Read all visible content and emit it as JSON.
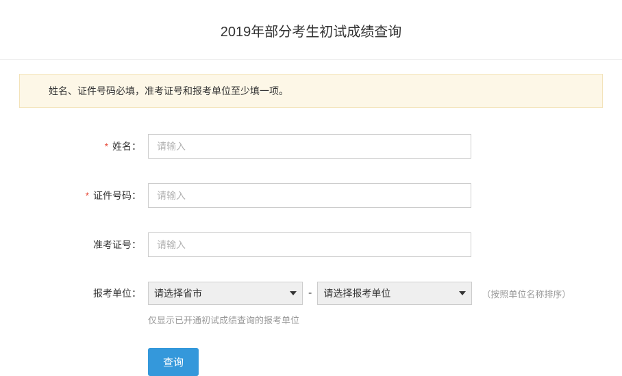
{
  "page": {
    "title": "2019年部分考生初试成绩查询"
  },
  "alert": {
    "message": "姓名、证件号码必填，准考证号和报考单位至少填一项。"
  },
  "form": {
    "name": {
      "label": "姓名：",
      "placeholder": "请输入",
      "required": true
    },
    "idNumber": {
      "label": "证件号码：",
      "placeholder": "请输入",
      "required": true
    },
    "examNumber": {
      "label": "准考证号：",
      "placeholder": "请输入",
      "required": false
    },
    "org": {
      "label": "报考单位：",
      "provinceDefault": "请选择省市",
      "orgDefault": "请选择报考单位",
      "separator": "-",
      "sortHint": "（按照单位名称排序）",
      "helpText": "仅显示已开通初试成绩查询的报考单位"
    },
    "submit": {
      "label": "查询"
    }
  }
}
